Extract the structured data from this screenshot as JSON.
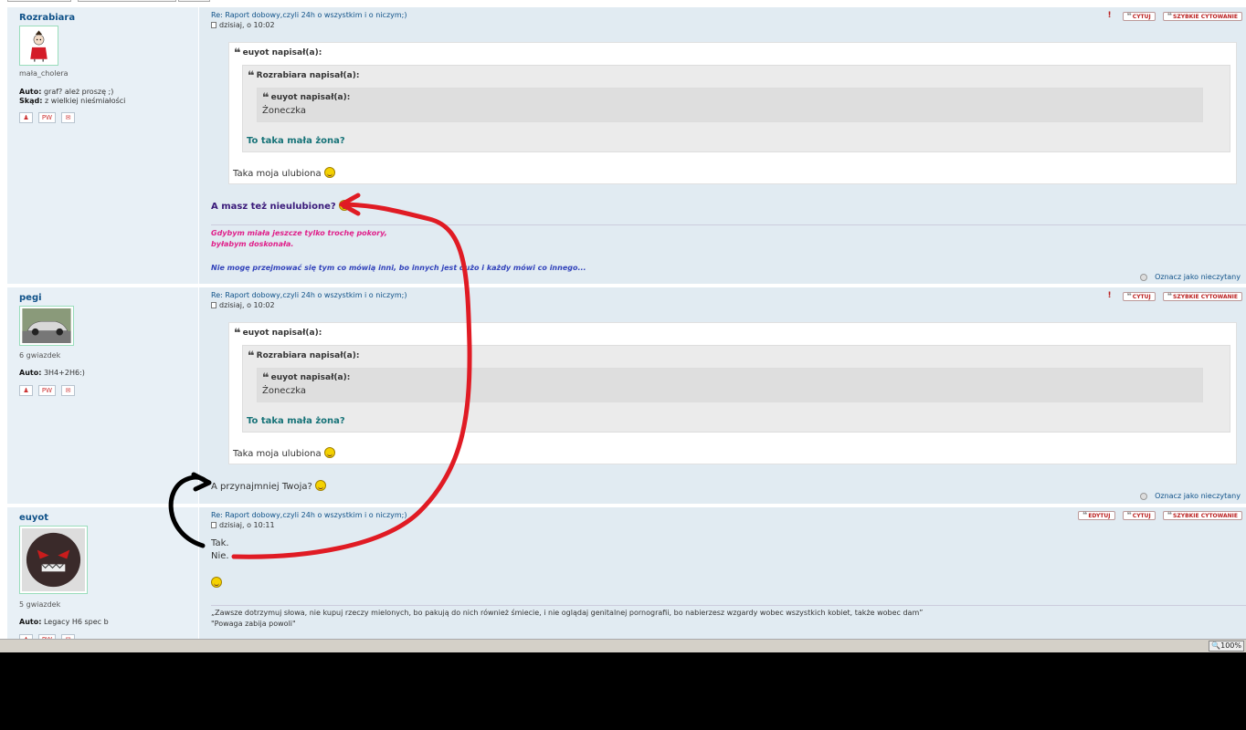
{
  "topic_title": "Re: Raport dobowy,czyli 24h o wszystkim i o niczym;)",
  "buttons": {
    "edit": "EDYTUJ",
    "quote": "CYTUJ",
    "quick_quote": "SZYBKIE CYTOWANIE",
    "pm": "PW"
  },
  "mark_unread": "Oznacz jako nieczytany",
  "posts": [
    {
      "author": "Rozrabiara",
      "rank": "mała_cholera",
      "fields": [
        {
          "label": "Auto:",
          "value": "graf? ależ proszę ;)"
        },
        {
          "label": "Skąd:",
          "value": "z wielkiej nieśmiałości"
        }
      ],
      "date": "dzisiaj, o 10:02",
      "quote_outer_header": "euyot napisał(a):",
      "quote_mid_header": "Rozrabiara napisał(a):",
      "quote_inner_header": "euyot napisał(a):",
      "quote_inner_text": "Żoneczka",
      "quote_mid_text": "To taka mała żona?",
      "quote_outer_text": "Taka moja ulubiona",
      "reply": "A masz też nieulubione?",
      "signature": [
        "Gdybym miała jeszcze tylko trochę pokory,",
        "byłabym doskonała.",
        "Nie mogę przejmować się tym co mówią inni, bo innych jest dużo i każdy mówi co innego..."
      ]
    },
    {
      "author": "pegi",
      "rank": "6 gwiazdek",
      "fields": [
        {
          "label": "Auto:",
          "value": "3H4+2H6:)"
        }
      ],
      "date": "dzisiaj, o 10:02",
      "quote_outer_header": "euyot napisał(a):",
      "quote_mid_header": "Rozrabiara napisał(a):",
      "quote_inner_header": "euyot napisał(a):",
      "quote_inner_text": "Żoneczka",
      "quote_mid_text": "To taka mała żona?",
      "quote_outer_text": "Taka moja ulubiona",
      "reply": "A przynajmniej Twoja?"
    },
    {
      "author": "euyot",
      "rank": "5 gwiazdek",
      "fields": [
        {
          "label": "Auto:",
          "value": "Legacy H6 spec b"
        }
      ],
      "date": "dzisiaj, o 10:11",
      "line1": "Tak.",
      "line2": "Nie.",
      "signature": [
        "„Zawsze dotrzymuj słowa, nie kupuj rzeczy mielonych, bo pakują do nich również śmiecie, i nie oglądaj genitalnej pornografii, bo nabierzesz wzgardy wobec wszystkich kobiet, także wobec dam”",
        "\"Powaga zabija powoli\""
      ]
    }
  ],
  "status": {
    "zoom": "100%"
  },
  "colors": {
    "post_bg": "#e1ebf2",
    "link": "#105289",
    "annotation_red": "#e01b24",
    "annotation_black": "#000000"
  }
}
